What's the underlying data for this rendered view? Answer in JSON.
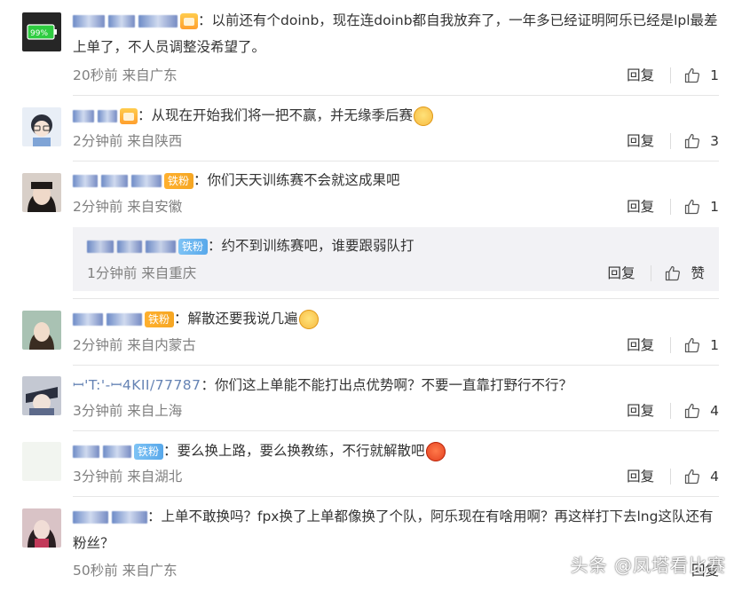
{
  "comments": [
    {
      "text": "：以前还有个doinb，现在连doinb都自我放弃了，一年多已经证明阿乐已经是lpl最差上单了，不人员调整没希望了。",
      "meta": "20秒前 来自广东",
      "reply": "回复",
      "likes": "1",
      "avatar_text": "99%",
      "avatar_color": "#2e2e2e"
    },
    {
      "text": "：从现在开始我们将一把不赢，并无缘季后赛",
      "meta": "2分钟前 来自陕西",
      "reply": "回复",
      "likes": "3",
      "avatar_color": "#cfd8e6"
    },
    {
      "badge": "铁粉",
      "text": "：你们天天训练赛不会就这成果吧",
      "meta": "2分钟前 来自安徽",
      "reply": "回复",
      "likes": "1",
      "avatar_color": "#bfa99a"
    },
    {
      "badge": "铁粉",
      "text": "：解散还要我说几遍",
      "meta": "2分钟前 来自内蒙古",
      "reply": "回复",
      "likes": "1",
      "avatar_color": "#8fb0a0"
    },
    {
      "handle": "ꟷ'T:'-ꟷ4KII/77787",
      "text": "：你们这上单能不能打出点优势啊？不要一直靠打野行不行？",
      "meta": "3分钟前 来自上海",
      "reply": "回复",
      "likes": "4",
      "avatar_color": "#9aa0b0"
    },
    {
      "badge": "铁粉",
      "text": "：要么换上路，要么换教练，不行就解散吧",
      "meta": "3分钟前 来自湖北",
      "reply": "回复",
      "likes": "4",
      "avatar_color": "#f2f5f0"
    },
    {
      "text": "：上单不敢换吗？fpx换了上单都像换了个队，阿乐现在有啥用啊？再这样打下去lng这队还有粉丝？",
      "meta": "50秒前 来自广东",
      "reply": "回复",
      "avatar_color": "#c9a7ad"
    }
  ],
  "sub_reply": {
    "badge": "铁粉",
    "text": "：约不到训练赛吧，谁要跟弱队打",
    "meta": "1分钟前 来自重庆",
    "reply": "回复",
    "like_label": "赞"
  },
  "watermark": "头条 @凤塔看比赛",
  "colors": {
    "meta_gray": "#808080",
    "divider": "#e6e6e6",
    "sub_bg": "#f2f2f5",
    "badge_gold": "#f5a623",
    "badge_blue": "#58a8ea"
  },
  "icons": [
    "thumbs-up-icon",
    "crown-badge-icon",
    "battery-avatar-icon"
  ]
}
